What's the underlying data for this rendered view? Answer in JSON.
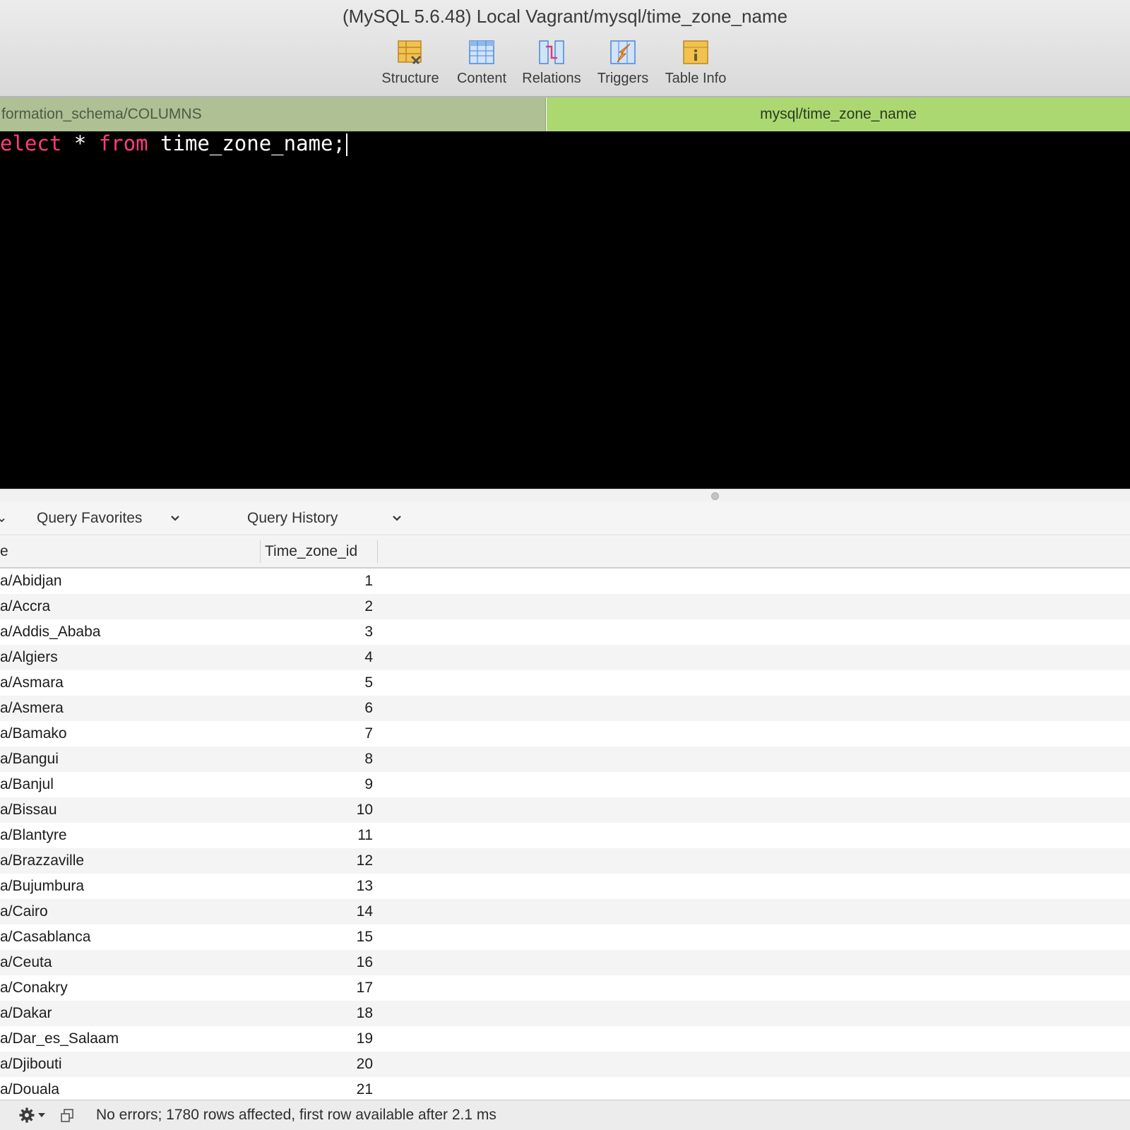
{
  "window": {
    "title": "(MySQL 5.6.48) Local Vagrant/mysql/time_zone_name"
  },
  "toolbar": {
    "buttons": [
      {
        "label": "Structure",
        "icon": "structure-icon"
      },
      {
        "label": "Content",
        "icon": "content-icon"
      },
      {
        "label": "Relations",
        "icon": "relations-icon"
      },
      {
        "label": "Triggers",
        "icon": "triggers-icon"
      },
      {
        "label": "Table Info",
        "icon": "table-info-icon"
      }
    ]
  },
  "tabs": [
    {
      "label": "formation_schema/COLUMNS",
      "active": false
    },
    {
      "label": "mysql/time_zone_name",
      "active": true
    }
  ],
  "editor": {
    "tokens": {
      "kw1": "elect",
      "sp1": " ",
      "star": "*",
      "sp2": " ",
      "kw2": "from",
      "rest": " time_zone_name;"
    }
  },
  "querybar": {
    "favorites_label": "Query Favorites",
    "history_label": "Query History"
  },
  "table": {
    "columns": [
      "e",
      "Time_zone_id"
    ],
    "rows": [
      [
        "a/Abidjan",
        "1"
      ],
      [
        "a/Accra",
        "2"
      ],
      [
        "a/Addis_Ababa",
        "3"
      ],
      [
        "a/Algiers",
        "4"
      ],
      [
        "a/Asmara",
        "5"
      ],
      [
        "a/Asmera",
        "6"
      ],
      [
        "a/Bamako",
        "7"
      ],
      [
        "a/Bangui",
        "8"
      ],
      [
        "a/Banjul",
        "9"
      ],
      [
        "a/Bissau",
        "10"
      ],
      [
        "a/Blantyre",
        "11"
      ],
      [
        "a/Brazzaville",
        "12"
      ],
      [
        "a/Bujumbura",
        "13"
      ],
      [
        "a/Cairo",
        "14"
      ],
      [
        "a/Casablanca",
        "15"
      ],
      [
        "a/Ceuta",
        "16"
      ],
      [
        "a/Conakry",
        "17"
      ],
      [
        "a/Dakar",
        "18"
      ],
      [
        "a/Dar_es_Salaam",
        "19"
      ],
      [
        "a/Djibouti",
        "20"
      ],
      [
        "a/Douala",
        "21"
      ]
    ]
  },
  "status": {
    "text": "No errors; 1780 rows affected, first row available after 2.1 ms"
  },
  "colors": {
    "keyword": "#ff3d7a",
    "active_tab": "#acd872",
    "inactive_tab": "#aec094"
  }
}
